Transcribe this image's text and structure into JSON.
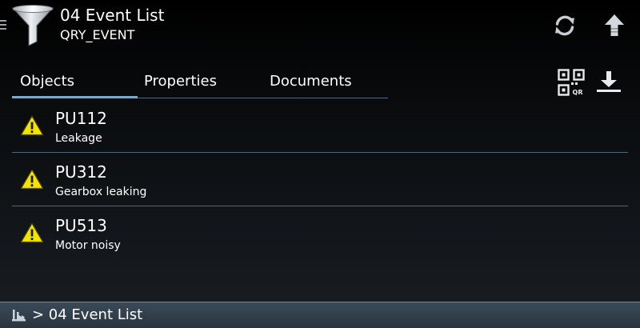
{
  "header": {
    "title": "04 Event List",
    "subtitle": "QRY_EVENT",
    "icons": {
      "menu": "menu-icon",
      "app": "filter-icon",
      "refresh": "refresh-icon",
      "upload": "upload-icon"
    }
  },
  "tabs": [
    {
      "label": "Objects",
      "selected": true
    },
    {
      "label": "Properties",
      "selected": false
    },
    {
      "label": "Documents",
      "selected": false
    }
  ],
  "toolbar": {
    "qr_icon": "qr-code-icon",
    "download_icon": "download-icon",
    "qr_glyph_text": "QR"
  },
  "items": [
    {
      "title": "PU112",
      "subtitle": "Leakage",
      "icon": "warning-icon"
    },
    {
      "title": "PU312",
      "subtitle": "Gearbox leaking",
      "icon": "warning-icon"
    },
    {
      "title": "PU513",
      "subtitle": "Motor noisy",
      "icon": "warning-icon"
    }
  ],
  "footer": {
    "breadcrumb": "> 04 Event List",
    "icon": "plant-icon"
  },
  "colors": {
    "accent": "#7ea7c8",
    "divider": "#4b6579",
    "warning_fill": "#f5e400",
    "footer_bg": "#33414d"
  }
}
